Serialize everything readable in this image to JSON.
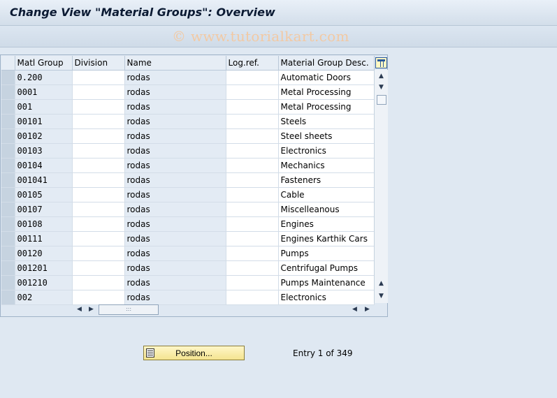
{
  "window": {
    "title": "Change View \"Material Groups\": Overview"
  },
  "watermark": "© www.tutorialkart.com",
  "table": {
    "columns": [
      "Matl Group",
      "Division",
      "Name",
      "Log.ref.",
      "Material Group Desc."
    ],
    "rows": [
      {
        "group": "0.200",
        "division": "",
        "name": "rodas",
        "logref": "",
        "desc": "Automatic Doors"
      },
      {
        "group": "0001",
        "division": "",
        "name": "rodas",
        "logref": "",
        "desc": "Metal Processing"
      },
      {
        "group": "001",
        "division": "",
        "name": "rodas",
        "logref": "",
        "desc": "Metal Processing"
      },
      {
        "group": "00101",
        "division": "",
        "name": "rodas",
        "logref": "",
        "desc": "Steels"
      },
      {
        "group": "00102",
        "division": "",
        "name": "rodas",
        "logref": "",
        "desc": "Steel sheets"
      },
      {
        "group": "00103",
        "division": "",
        "name": "rodas",
        "logref": "",
        "desc": "Electronics"
      },
      {
        "group": "00104",
        "division": "",
        "name": "rodas",
        "logref": "",
        "desc": "Mechanics"
      },
      {
        "group": "001041",
        "division": "",
        "name": "rodas",
        "logref": "",
        "desc": "Fasteners"
      },
      {
        "group": "00105",
        "division": "",
        "name": "rodas",
        "logref": "",
        "desc": "Cable"
      },
      {
        "group": "00107",
        "division": "",
        "name": "rodas",
        "logref": "",
        "desc": "Miscelleanous"
      },
      {
        "group": "00108",
        "division": "",
        "name": "rodas",
        "logref": "",
        "desc": "Engines"
      },
      {
        "group": "00111",
        "division": "",
        "name": "rodas",
        "logref": "",
        "desc": "Engines Karthik Cars"
      },
      {
        "group": "00120",
        "division": "",
        "name": "rodas",
        "logref": "",
        "desc": "Pumps"
      },
      {
        "group": "001201",
        "division": "",
        "name": "rodas",
        "logref": "",
        "desc": "Centrifugal Pumps"
      },
      {
        "group": "001210",
        "division": "",
        "name": "rodas",
        "logref": "",
        "desc": "Pumps Maintenance"
      },
      {
        "group": "002",
        "division": "",
        "name": "rodas",
        "logref": "",
        "desc": "Electronics"
      }
    ]
  },
  "footer": {
    "position_button": "Position...",
    "entry_text": "Entry 1 of 349"
  }
}
